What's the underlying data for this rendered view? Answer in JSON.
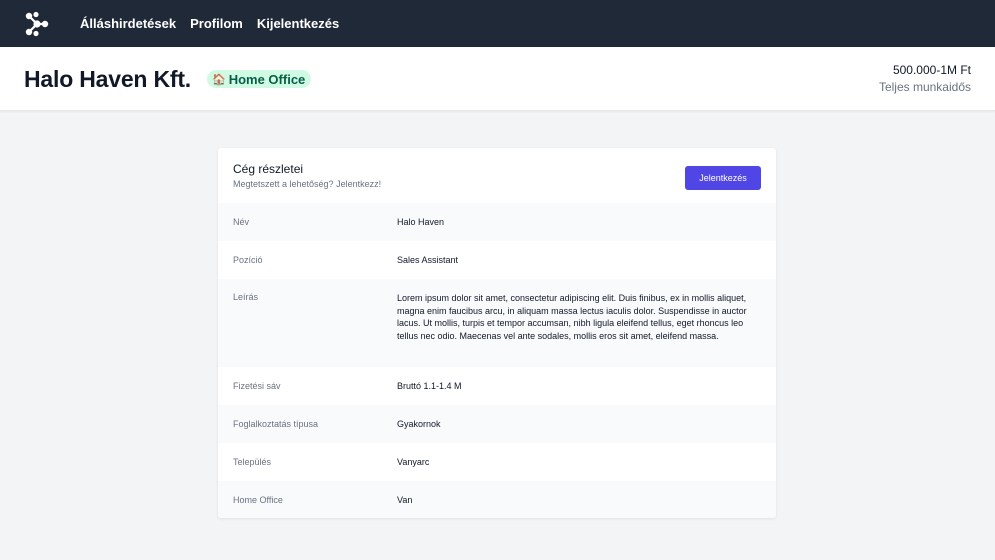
{
  "nav": {
    "logo_icon": "logo-icon",
    "links": [
      "Álláshirdetések",
      "Profilom",
      "Kijelentkezés"
    ]
  },
  "header": {
    "company": "Halo Haven Kft.",
    "badge": {
      "icon": "house-icon",
      "label": "Home Office",
      "bg": "#d1fae5",
      "color": "#065f46"
    },
    "salary": "500.000-1M Ft",
    "job_type": "Teljes munkaidős"
  },
  "card": {
    "title": "Cég részletei",
    "subtitle": "Megtetszett a lehetőség? Jelentkezz!",
    "apply_button": "Jelentkezés",
    "accent": "#4f46e5",
    "rows": [
      {
        "label": "Név",
        "value": "Halo Haven"
      },
      {
        "label": "Pozíció",
        "value": "Sales Assistant"
      },
      {
        "label": "Leírás",
        "value": "Lorem ipsum dolor sit amet, consectetur adipiscing elit. Duis finibus,  ex in mollis aliquet, magna enim faucibus arcu, in aliquam massa lectus  iaculis dolor. Suspendisse in auctor lacus. Ut mollis, turpis et tempor  accumsan, nibh ligula eleifend tellus, eget rhoncus leo tellus nec odio.  Maecenas vel ante sodales, mollis eros sit amet, eleifend massa."
      },
      {
        "label": "Fizetési sáv",
        "value": "Bruttó 1.1-1.4 M"
      },
      {
        "label": "Foglalkoztatás típusa",
        "value": "Gyakornok"
      },
      {
        "label": "Település",
        "value": "Vanyarc"
      },
      {
        "label": "Home Office",
        "value": "Van"
      }
    ]
  }
}
